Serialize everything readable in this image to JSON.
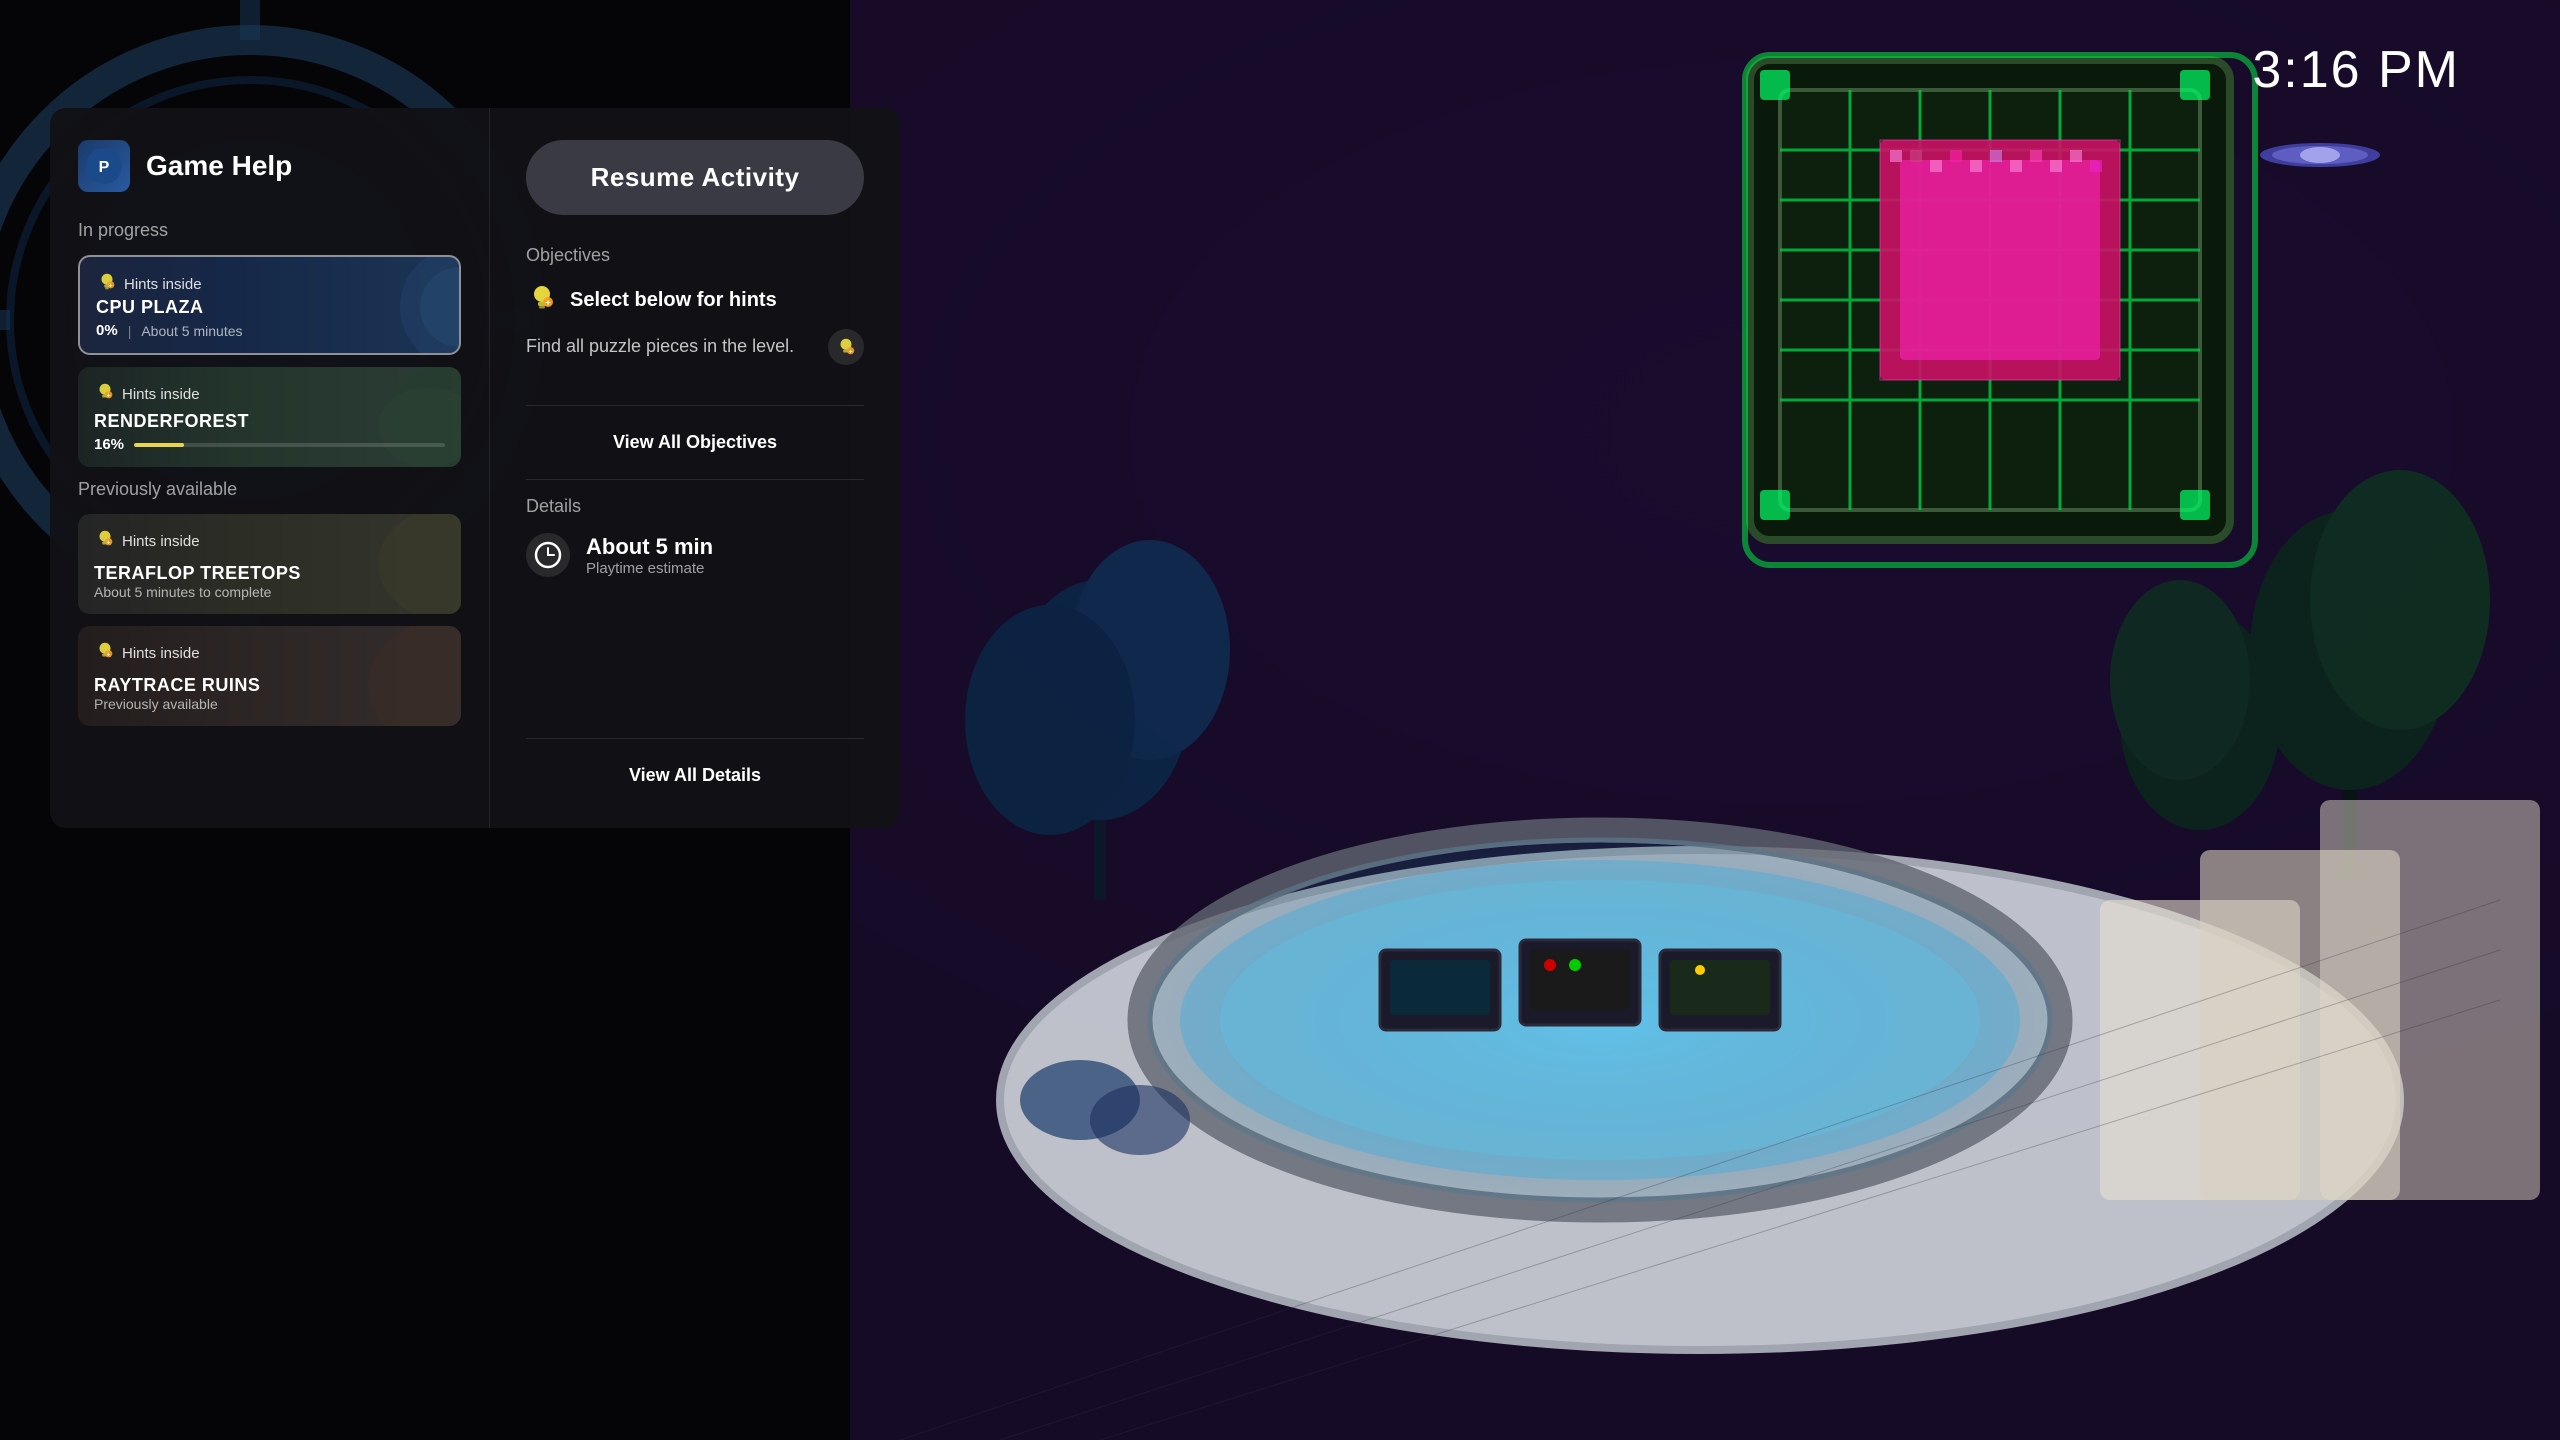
{
  "time": "3:16 PM",
  "panel": {
    "title": "Game Help",
    "in_progress_label": "In progress",
    "previously_available_label": "Previously available"
  },
  "resume_button": "Resume Activity",
  "objectives": {
    "label": "Objectives",
    "select_hint": "Select below for hints",
    "description": "Find all puzzle pieces in the level.",
    "view_all": "View All Objectives"
  },
  "details": {
    "label": "Details",
    "playtime_amount": "About 5 min",
    "playtime_label": "Playtime estimate",
    "view_all": "View All Details"
  },
  "activities_in_progress": [
    {
      "title": "CPU PLAZA",
      "progress": "0%",
      "progress_value": 0,
      "subtitle": "About 5 minutes",
      "hints_label": "Hints inside",
      "active": true
    },
    {
      "title": "RENDERFOREST",
      "progress": "16%",
      "progress_value": 16,
      "subtitle": null,
      "hints_label": "Hints inside",
      "active": false
    }
  ],
  "activities_previously": [
    {
      "title": "TERAFLOP TREETOPS",
      "subtitle": "About 5 minutes to complete",
      "hints_label": "Hints inside",
      "active": false
    },
    {
      "title": "RAYTRACE RUINS",
      "subtitle": "Previously available",
      "hints_label": "Hints inside",
      "active": false
    }
  ],
  "icons": {
    "bulb": "💡",
    "clock": "🕐"
  }
}
